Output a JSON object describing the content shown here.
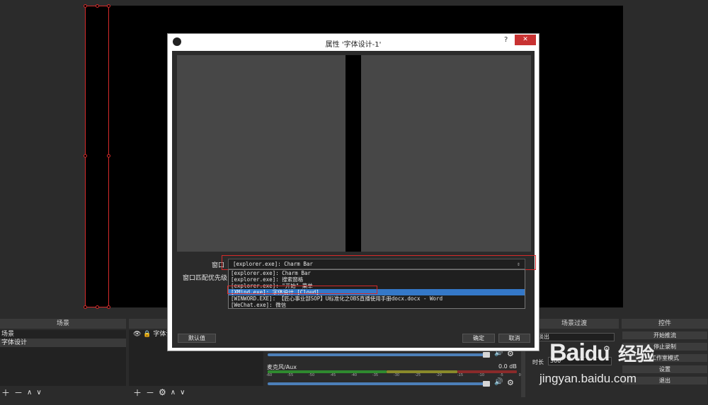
{
  "dialog": {
    "title": "属性 '字体设计-1'",
    "help_glyph": "?",
    "close_glyph": "✕",
    "window_label": "窗口",
    "priority_label": "窗口匹配优先级",
    "window_value": "[explorer.exe]: Charm Bar",
    "window_options": [
      "[explorer.exe]: Charm Bar",
      "[explorer.exe]: 搜索窗格",
      "[explorer.exe]: \"开始\" 菜单",
      "[XMind.exe]: 字体设计 [Cloud]",
      "[WINWORD.EXE]: 【匠心事业部SOP】U标准化之OBS直播使用手册docx.docx - Word",
      "[WeChat.exe]: 微信"
    ],
    "selected_index": 3,
    "defaults_button": "默认值",
    "ok_button": "确定",
    "cancel_button": "取消"
  },
  "scenes": {
    "header": "场景",
    "items": [
      "场景",
      "字体设计"
    ],
    "selected_index": 1
  },
  "sources": {
    "items": [
      "字体设"
    ]
  },
  "mixer": {
    "mic_label": "麦克风/Aux",
    "db_value": "0.0 dB",
    "scale": [
      "-60",
      "-55",
      "-50",
      "-45",
      "-40",
      "-35",
      "-30",
      "-25",
      "-20",
      "-15",
      "-10",
      "-5",
      "0"
    ]
  },
  "transitions": {
    "header": "场景过渡",
    "fade_label": "淡出",
    "duration_label": "时长",
    "duration_value": "300"
  },
  "controls": {
    "header": "控件",
    "buttons": [
      "开始推流",
      "停止录制",
      "工作室模式",
      "设置",
      "退出"
    ]
  },
  "watermark": {
    "brand": "Bai",
    "brand_paw": "du",
    "cn": "经验",
    "url": "jingyan.baidu.com"
  },
  "colors": {
    "selection": "#3478c8",
    "source_outline": "#d42a2a",
    "volume_bar": "#4c7fb8"
  }
}
